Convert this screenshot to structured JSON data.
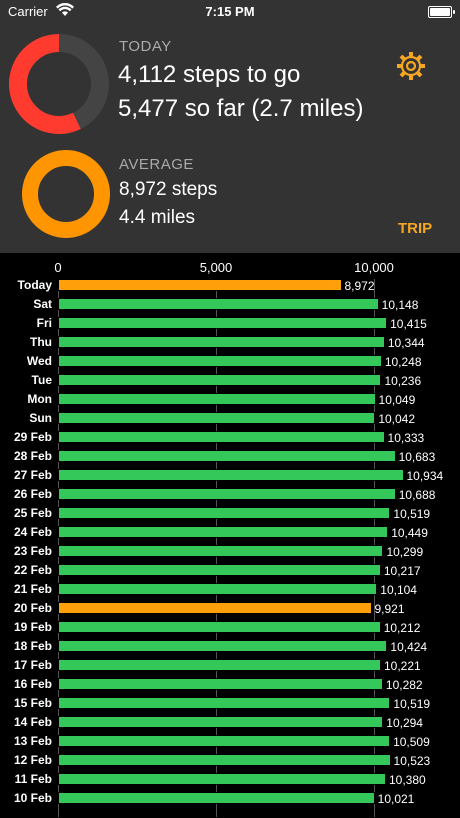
{
  "status": {
    "carrier": "Carrier",
    "time": "7:15 PM"
  },
  "today": {
    "label": "TODAY",
    "line1": "4,112 steps to go",
    "line2": "5,477 so far (2.7 miles)",
    "progress": 0.571,
    "ring_color": "#ff3b30"
  },
  "average": {
    "label": "AVERAGE",
    "line1": "8,972 steps",
    "line2": "4.4 miles",
    "progress": 1.0,
    "ring_color": "#ff9500"
  },
  "trip_label": "TRIP",
  "colors": {
    "green": "#34c759",
    "orange": "#ff9f0a",
    "header_bg": "#333333",
    "accent": "#f5a623"
  },
  "chart_data": {
    "type": "bar",
    "orientation": "horizontal",
    "x_ticks": [
      "0",
      "5,000",
      "10,000"
    ],
    "xlim": [
      0,
      11500
    ],
    "categories": [
      "Today",
      "Sat",
      "Fri",
      "Thu",
      "Wed",
      "Tue",
      "Mon",
      "Sun",
      "29 Feb",
      "28 Feb",
      "27 Feb",
      "26 Feb",
      "25 Feb",
      "24 Feb",
      "23 Feb",
      "22 Feb",
      "21 Feb",
      "20 Feb",
      "19 Feb",
      "18 Feb",
      "17 Feb",
      "16 Feb",
      "15 Feb",
      "14 Feb",
      "13 Feb",
      "12 Feb",
      "11 Feb",
      "10 Feb"
    ],
    "values": [
      8972,
      10148,
      10415,
      10344,
      10248,
      10236,
      10049,
      10042,
      10333,
      10683,
      10934,
      10688,
      10519,
      10449,
      10299,
      10217,
      10104,
      9921,
      10212,
      10424,
      10221,
      10282,
      10519,
      10294,
      10509,
      10523,
      10380,
      10021
    ],
    "value_labels": [
      "8,972",
      "10,148",
      "10,415",
      "10,344",
      "10,248",
      "10,236",
      "10,049",
      "10,042",
      "10,333",
      "10,683",
      "10,934",
      "10,688",
      "10,519",
      "10,449",
      "10,299",
      "10,217",
      "10,104",
      "9,921",
      "10,212",
      "10,424",
      "10,221",
      "10,282",
      "10,519",
      "10,294",
      "10,509",
      "10,523",
      "10,380",
      "10,021"
    ],
    "goal": 10000
  }
}
